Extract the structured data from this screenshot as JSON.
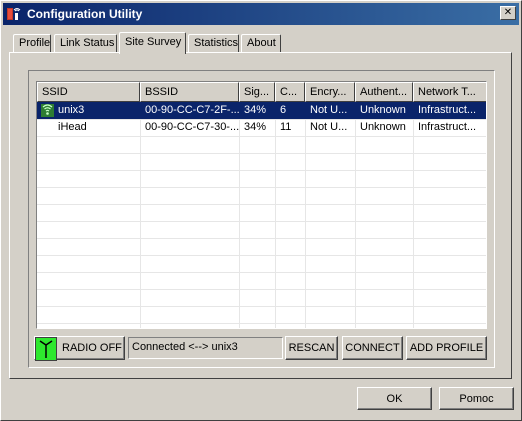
{
  "window": {
    "title": "Configuration Utility",
    "close_glyph": "✕"
  },
  "tabs": [
    {
      "label": "Profile"
    },
    {
      "label": "Link Status"
    },
    {
      "label": "Site Survey",
      "active": true
    },
    {
      "label": "Statistics"
    },
    {
      "label": "About"
    }
  ],
  "table": {
    "columns": [
      "SSID",
      "BSSID",
      "Sig...",
      "C...",
      "Encry...",
      "Authent...",
      "Network T..."
    ],
    "rows": [
      {
        "ssid": "unix3",
        "bssid": "00-90-CC-C7-2F-...",
        "signal": "34%",
        "channel": "6",
        "encryption": "Not U...",
        "auth": "Unknown",
        "network_type": "Infrastruct...",
        "selected": true,
        "icon": "connected-network-icon"
      },
      {
        "ssid": "iHead",
        "bssid": "00-90-CC-C7-30-...",
        "signal": "34%",
        "channel": "11",
        "encryption": "Not U...",
        "auth": "Unknown",
        "network_type": "Infrastruct...",
        "selected": false
      }
    ]
  },
  "controls": {
    "radio_off_label": "RADIO OFF",
    "radio_icon": "antenna-icon",
    "status_text": "Connected <--> unix3",
    "rescan_label": "RESCAN",
    "connect_label": "CONNECT",
    "add_profile_label": "ADD PROFILE"
  },
  "footer": {
    "ok_label": "OK",
    "help_label": "Pomoc"
  },
  "colors": {
    "selection": "#0a246a",
    "radio_green": "#2ee82e",
    "face": "#d4d0c8"
  }
}
